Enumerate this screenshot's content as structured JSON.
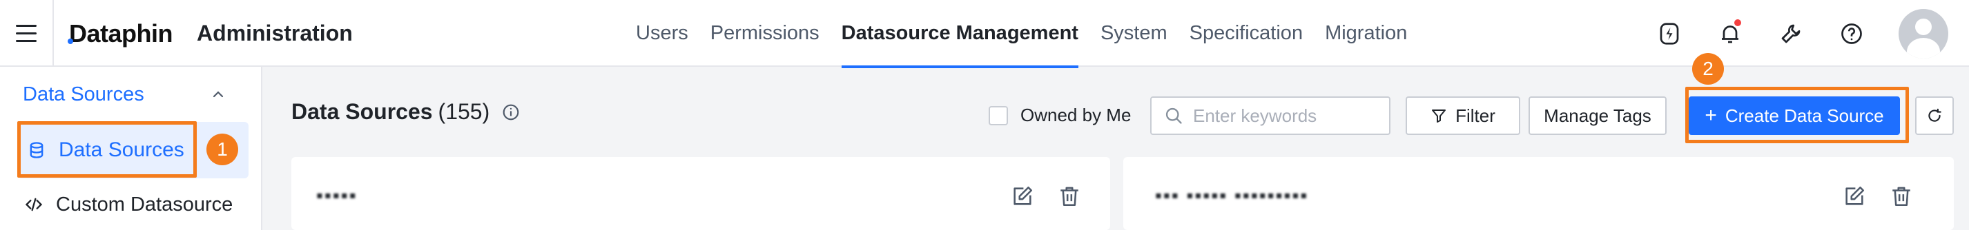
{
  "header": {
    "logo_text": "Dataphin",
    "app_title": "Administration",
    "nav": [
      {
        "label": "Users"
      },
      {
        "label": "Permissions"
      },
      {
        "label": "Datasource Management",
        "active": true
      },
      {
        "label": "System"
      },
      {
        "label": "Specification"
      },
      {
        "label": "Migration"
      }
    ],
    "icons": [
      "lightning-icon",
      "bell-icon",
      "wrench-icon",
      "help-icon",
      "avatar"
    ],
    "accent_color": "#1e6fff"
  },
  "sidebar": {
    "group_label": "Data Sources",
    "items": [
      {
        "label": "Data Sources",
        "active": true
      },
      {
        "label": "Custom Datasource"
      }
    ]
  },
  "main": {
    "title": "Data Sources",
    "count": "(155)",
    "owned_by_me_label": "Owned by Me",
    "search_placeholder": "Enter keywords",
    "filter_label": "Filter",
    "manage_tags_label": "Manage Tags",
    "create_label": "Create Data Source",
    "cards": [
      {
        "title": "▪▪▪▪▪"
      },
      {
        "title": "▪▪▪ ▪▪▪▪▪ ▪▪▪▪▪▪▪▪▪"
      }
    ]
  },
  "annotations": [
    {
      "number": "1",
      "color": "#f47c1c"
    },
    {
      "number": "2",
      "color": "#f47c1c"
    }
  ]
}
